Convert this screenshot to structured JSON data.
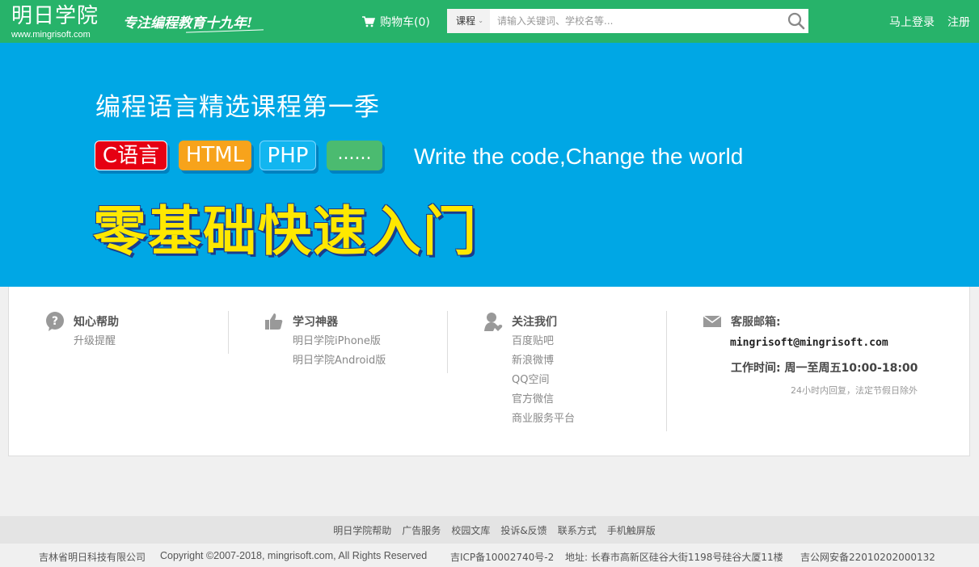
{
  "header": {
    "logo_cn": "明日学院",
    "logo_en": "www.mingrisoft.com",
    "slogan": "专注编程教育十九年!",
    "cart_label": "购物车(0)",
    "search_category": "课程",
    "search_placeholder": "请输入关键词、学校名等...",
    "login": "马上登录",
    "register": "注册"
  },
  "banner": {
    "title": "编程语言精选课程第一季",
    "tags": [
      "C语言",
      "HTML",
      "PHP",
      "......"
    ],
    "motto": "Write the code,Change the world",
    "headline": "零基础快速入门"
  },
  "info": {
    "help": {
      "title": "知心帮助",
      "items": [
        "升级提醒"
      ]
    },
    "tools": {
      "title": "学习神器",
      "items": [
        "明日学院iPhone版",
        "明日学院Android版"
      ]
    },
    "follow": {
      "title": "关注我们",
      "items": [
        "百度贴吧",
        "新浪微博",
        "QQ空间",
        "官方微信",
        "商业服务平台"
      ]
    },
    "service": {
      "title": "客服邮箱:",
      "email": "mingrisoft@mingrisoft.com",
      "hours": "工作时间: 周一至周五10:00-18:00",
      "note": "24小时内回复，法定节假日除外"
    }
  },
  "footer": {
    "links": [
      "明日学院帮助",
      "广告服务",
      "校园文库",
      "投诉&反馈",
      "联系方式",
      "手机触屏版"
    ],
    "company": "吉林省明日科技有限公司",
    "copyright": "Copyright ©2007-2018, mingrisoft.com, All Rights Reserved",
    "icp": "吉ICP备10002740号-2",
    "address": "地址: 长春市高新区硅谷大街1198号硅谷大厦11楼",
    "police": "吉公网安备22010202000132"
  },
  "colors": {
    "header": "#27b36a",
    "banner": "#00a7e5",
    "headline": "#ffe800"
  }
}
